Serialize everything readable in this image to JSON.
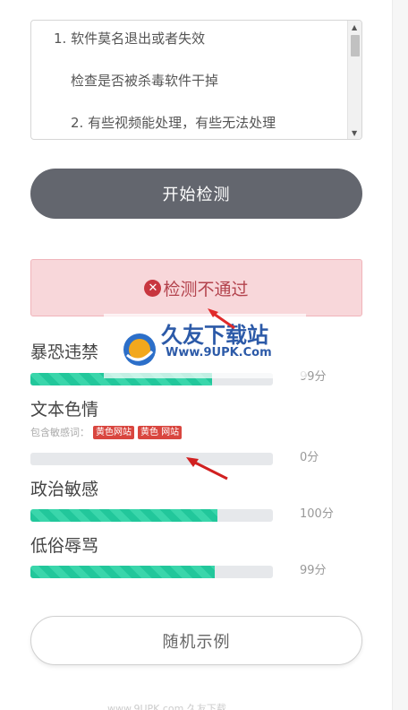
{
  "textbox": {
    "lines": [
      "1. 软件莫名退出或者失效",
      "检查是否被杀毒软件干掉",
      "2. 有些视频能处理，有些无法处理"
    ]
  },
  "start_button": {
    "label": "开始检测"
  },
  "result": {
    "icon": "error-circle-icon",
    "text": "检测不通过",
    "color": "#c8363f"
  },
  "categories": [
    {
      "label": "暴恐违禁",
      "score": "99分",
      "progress": 0.75
    },
    {
      "label": "文本色情",
      "score": "0分",
      "progress": 0,
      "sensitive_label": "包含敏感词：",
      "tags": [
        "黄色网站",
        "黄色 网站"
      ]
    },
    {
      "label": "政治敏感",
      "score": "100分",
      "progress": 0.77
    },
    {
      "label": "低俗辱骂",
      "score": "99分",
      "progress": 0.76
    }
  ],
  "random_button": {
    "label": "随机示例"
  },
  "watermark": {
    "title": "久友下载站",
    "url": "Www.9UPK.Com",
    "faint_url": "www.9UPK.com"
  },
  "footer": {
    "text": "www.9UPK.com  久友下载"
  },
  "colors": {
    "progress_fill": "#22c79b",
    "error_bg": "#f8d7da",
    "button_dark": "#63666e"
  }
}
